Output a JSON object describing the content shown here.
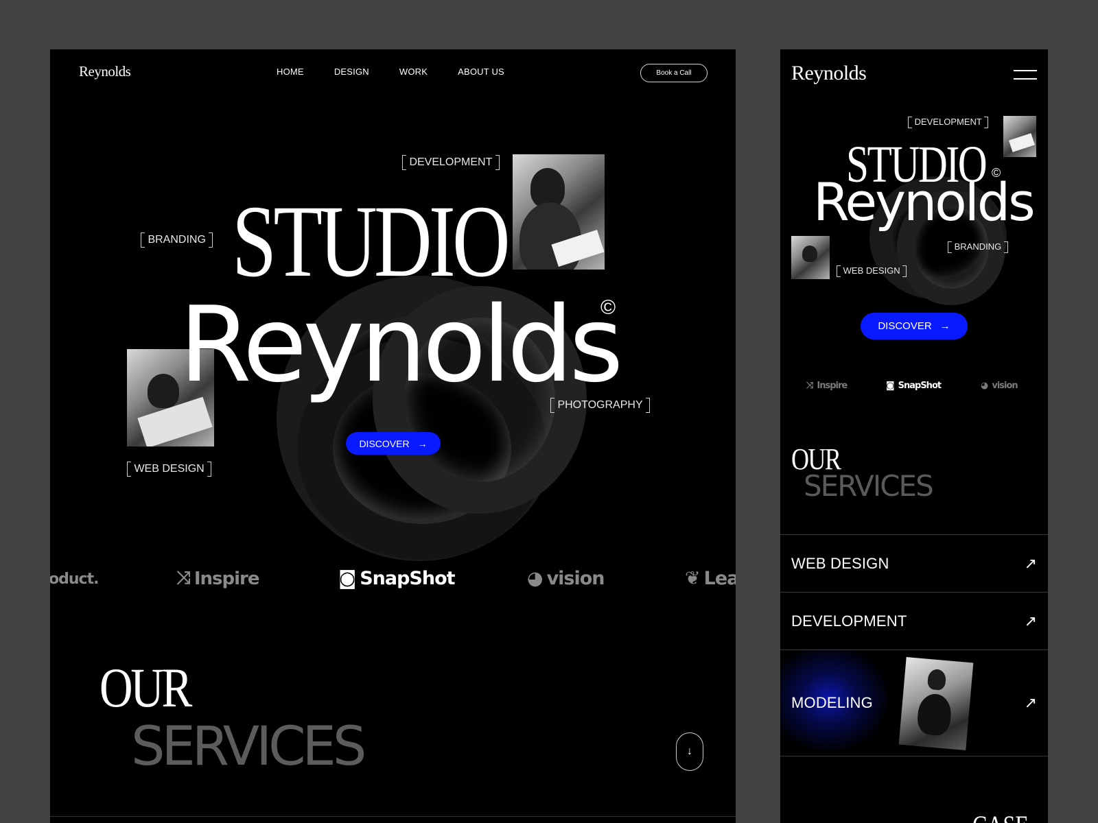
{
  "desktop": {
    "logo": "Reynolds",
    "nav": [
      "HOME",
      "DESIGN",
      "WORK",
      "ABOUT US"
    ],
    "book_call": "Book a Call",
    "hero": {
      "title_line1": "STUDIO",
      "title_line2": "Reynolds",
      "copyright": "©",
      "tags": {
        "development": "DEVELOPMENT",
        "branding": "BRANDING",
        "photography": "PHOTOGRAPHY",
        "web_design": "WEB DESIGN"
      },
      "discover": "DISCOVER"
    },
    "brands": [
      "oduct.",
      "Inspire",
      "SnapShot",
      "vision",
      "Leaf"
    ],
    "services": {
      "line1": "OUR",
      "line2": "SERVICES"
    }
  },
  "mobile": {
    "logo": "Reynolds",
    "hero": {
      "title_line1": "STUDIO",
      "title_line2": "Reynolds",
      "copyright": "©",
      "tags": {
        "development": "DEVELOPMENT",
        "branding": "BRANDING",
        "web_design": "WEB DESIGN"
      },
      "discover": "DISCOVER"
    },
    "brands": [
      "Inspire",
      "SnapShot",
      "vision"
    ],
    "services": {
      "line1": "OUR",
      "line2": "SERVICES",
      "items": [
        "WEB DESIGN",
        "DEVELOPMENT",
        "MODELING"
      ]
    },
    "case_heading": "CASE"
  },
  "colors": {
    "accent": "#0a1aff",
    "background": "#000000",
    "canvas": "#424242",
    "muted": "#5c5c5c"
  },
  "icons": {
    "arrow_right": "→",
    "arrow_diag": "↗",
    "arrow_down": "↓",
    "menu": "hamburger-icon"
  }
}
